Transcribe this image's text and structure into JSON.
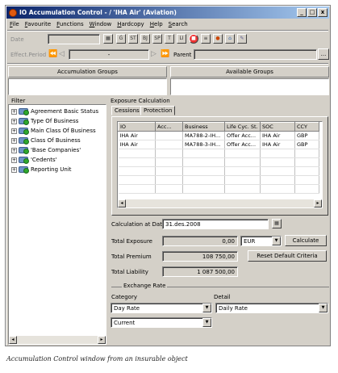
{
  "window": {
    "title": "IO Accumulation Control - / 'IHA Air' (Aviation)",
    "controls": [
      "_",
      "□",
      "x"
    ]
  },
  "menu": [
    "File",
    "Favourite",
    "Functions",
    "Window",
    "Hardcopy",
    "Help",
    "Search"
  ],
  "toolbar": {
    "date_label": "Date",
    "effect_period_label": "Effect.Period",
    "parent_label": "Parent",
    "dash": "-",
    "ellipsis": "...",
    "icons": [
      "calendar-icon",
      "accumulation-icon",
      "settings-icon",
      "bj-icon",
      "sp-icon",
      "tree-icon",
      "list-icon",
      "stop-icon",
      "filter-icon",
      "rating-icon",
      "home-icon",
      "tools-icon"
    ]
  },
  "groups": {
    "accumulation_groups": "Accumulation Groups",
    "available_groups": "Available Groups"
  },
  "filter": {
    "title": "Filter",
    "items": [
      "Agreement Basic Status",
      "Type Of Business",
      "Main Class Of Business",
      "Class Of Business",
      "'Base Companies'",
      "'Cedents'",
      "Reporting Unit"
    ]
  },
  "exposure": {
    "title": "Exposure Calculation",
    "tabs": [
      "Cessions",
      "Protection"
    ],
    "columns": [
      "IO",
      "Acc...",
      "Business",
      "Life Cyc. St.",
      "SOC",
      "CCY"
    ],
    "rows": [
      [
        "IHA Air",
        "",
        "MA788-2-IH...",
        "Offer Acc...",
        "IHA Air",
        "GBP"
      ],
      [
        "IHA Air",
        "",
        "MA788-3-IH...",
        "Offer Acc...",
        "IHA Air",
        "GBP"
      ]
    ],
    "calc_date_label": "Calculation at Date",
    "calc_date": "31.des.2008",
    "total_exposure_label": "Total Exposure",
    "total_exposure": "0,00",
    "currency": "EUR",
    "calculate_button": "Calculate",
    "total_premium_label": "Total Premium",
    "total_premium": "108 750,00",
    "reset_button": "Reset Default Criteria",
    "total_liability_label": "Total Liability",
    "total_liability": "1 087 500,00",
    "exchange_rate_title": "Exchange Rate",
    "category_label": "Category",
    "detail_label": "Detail",
    "category_value": "Day Rate",
    "detail_value": "Daily Rate",
    "current_value": "Current"
  },
  "caption": "Accumulation Control window from an insurable object"
}
